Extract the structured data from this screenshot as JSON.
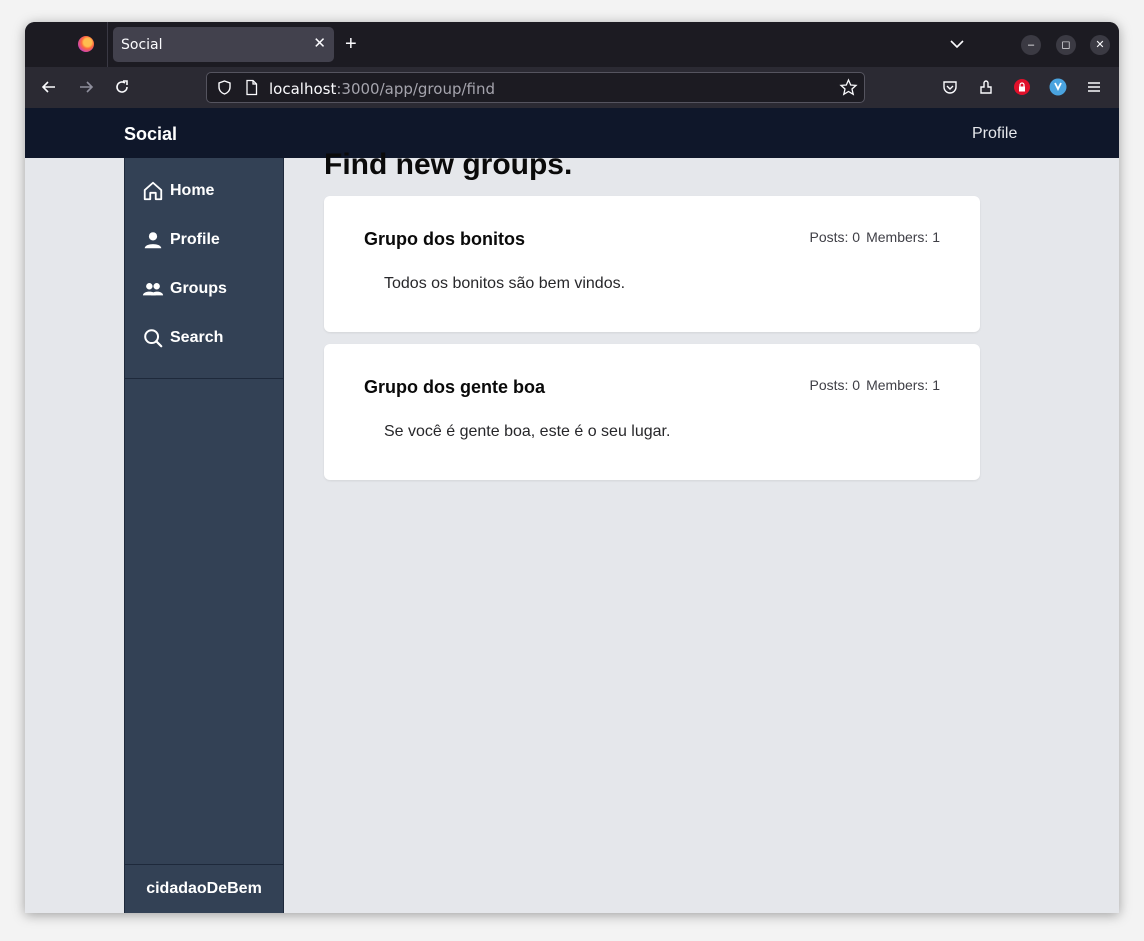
{
  "browser": {
    "tab_title": "Social",
    "url_host": "localhost",
    "url_path": ":3000/app/group/find"
  },
  "header": {
    "brand": "Social",
    "profile_link": "Profile"
  },
  "sidebar": {
    "items": [
      {
        "label": "Home",
        "icon": "home-icon"
      },
      {
        "label": "Profile",
        "icon": "user-icon"
      },
      {
        "label": "Groups",
        "icon": "users-icon"
      },
      {
        "label": "Search",
        "icon": "search-icon"
      }
    ],
    "username": "cidadaoDeBem"
  },
  "main": {
    "title": "Find new groups.",
    "groups": [
      {
        "name": "Grupo dos bonitos",
        "posts": "Posts: 0",
        "members": "Members: 1",
        "description": "Todos os bonitos são bem vindos."
      },
      {
        "name": "Grupo dos gente boa",
        "posts": "Posts: 0",
        "members": "Members: 1",
        "description": "Se você é gente boa, este é o seu lugar."
      }
    ]
  },
  "colors": {
    "app_header": "#0f172a",
    "sidebar": "#334155",
    "page_bg": "#e5e7eb"
  }
}
